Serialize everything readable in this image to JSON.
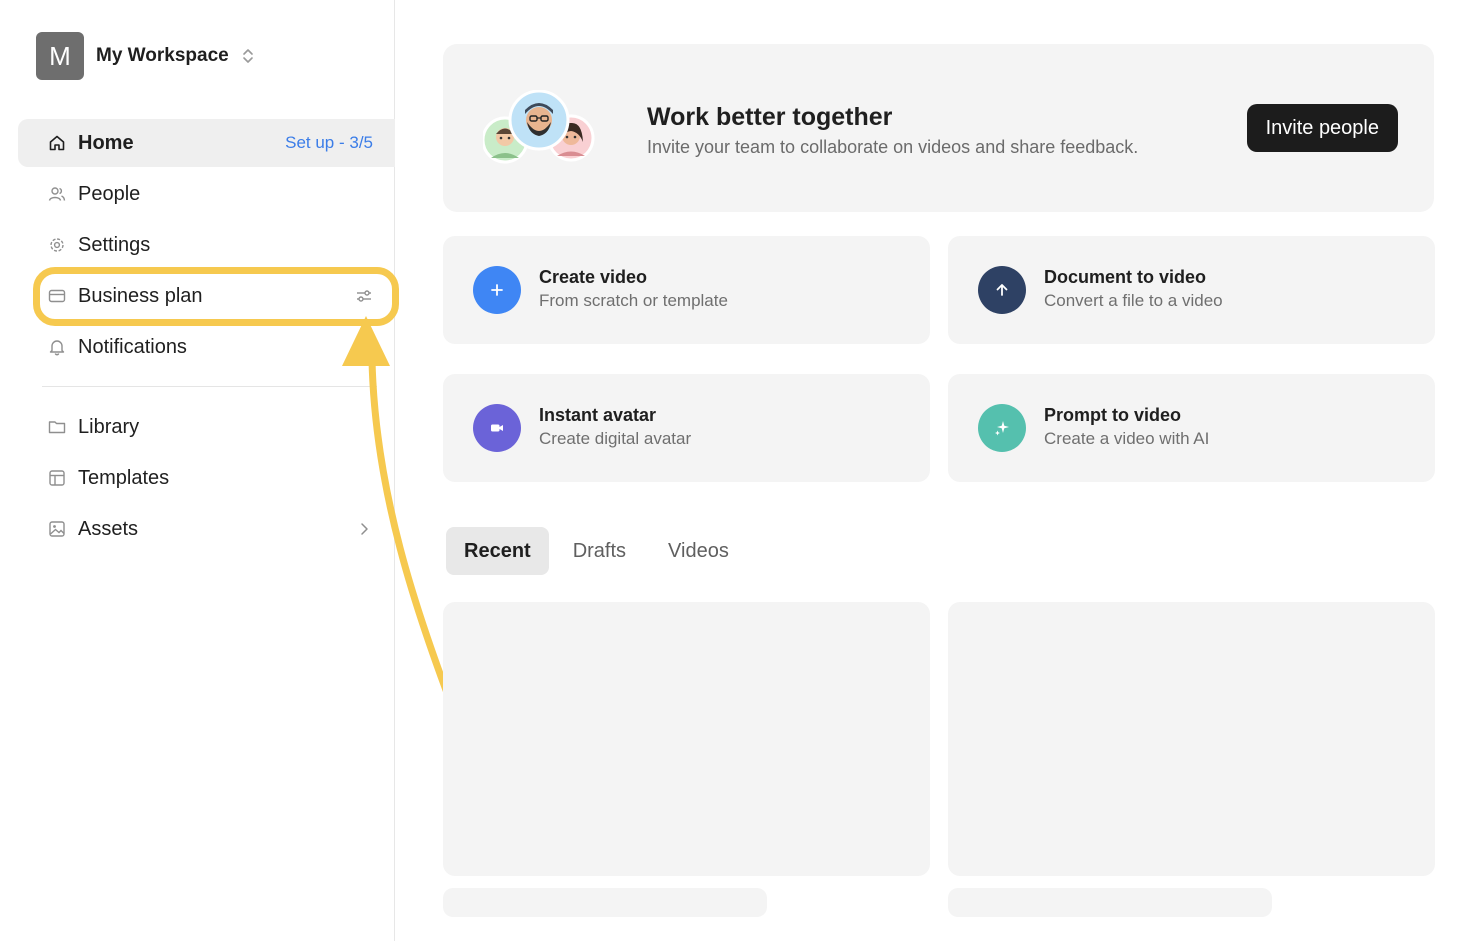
{
  "workspace": {
    "initial": "M",
    "name": "My Workspace"
  },
  "nav": {
    "items": [
      {
        "label": "Home",
        "icon": "home-icon",
        "badge": "Set up - 3/5",
        "active": true
      },
      {
        "label": "People",
        "icon": "people-icon"
      },
      {
        "label": "Settings",
        "icon": "gear-icon"
      },
      {
        "label": "Business plan",
        "icon": "credit-card-icon",
        "right_icon": "sliders-icon"
      },
      {
        "label": "Notifications",
        "icon": "bell-icon"
      }
    ],
    "secondary": [
      {
        "label": "Library",
        "icon": "folder-icon"
      },
      {
        "label": "Templates",
        "icon": "template-icon"
      },
      {
        "label": "Assets",
        "icon": "image-icon",
        "right_icon": "chevron-right-icon"
      }
    ]
  },
  "banner": {
    "title": "Work better together",
    "subtitle": "Invite your team to collaborate on videos and share feedback.",
    "button": "Invite people"
  },
  "actions": [
    {
      "title": "Create video",
      "subtitle": "From scratch or template",
      "icon": "plus-icon",
      "color": "#3f86f4"
    },
    {
      "title": "Document to video",
      "subtitle": "Convert a file to a video",
      "icon": "arrow-up-icon",
      "color": "#2e4164"
    },
    {
      "title": "Instant avatar",
      "subtitle": "Create digital avatar",
      "icon": "video-camera-icon",
      "color": "#6b63d8"
    },
    {
      "title": "Prompt to video",
      "subtitle": "Create a video with AI",
      "icon": "sparkle-icon",
      "color": "#55c0ae"
    }
  ],
  "tabs": [
    {
      "label": "Recent",
      "active": true
    },
    {
      "label": "Drafts"
    },
    {
      "label": "Videos"
    }
  ],
  "colors": {
    "accent_link": "#3b7de8",
    "highlight": "#f6c94f",
    "card_bg": "#f4f4f4",
    "primary_button": "#1c1c1c"
  }
}
